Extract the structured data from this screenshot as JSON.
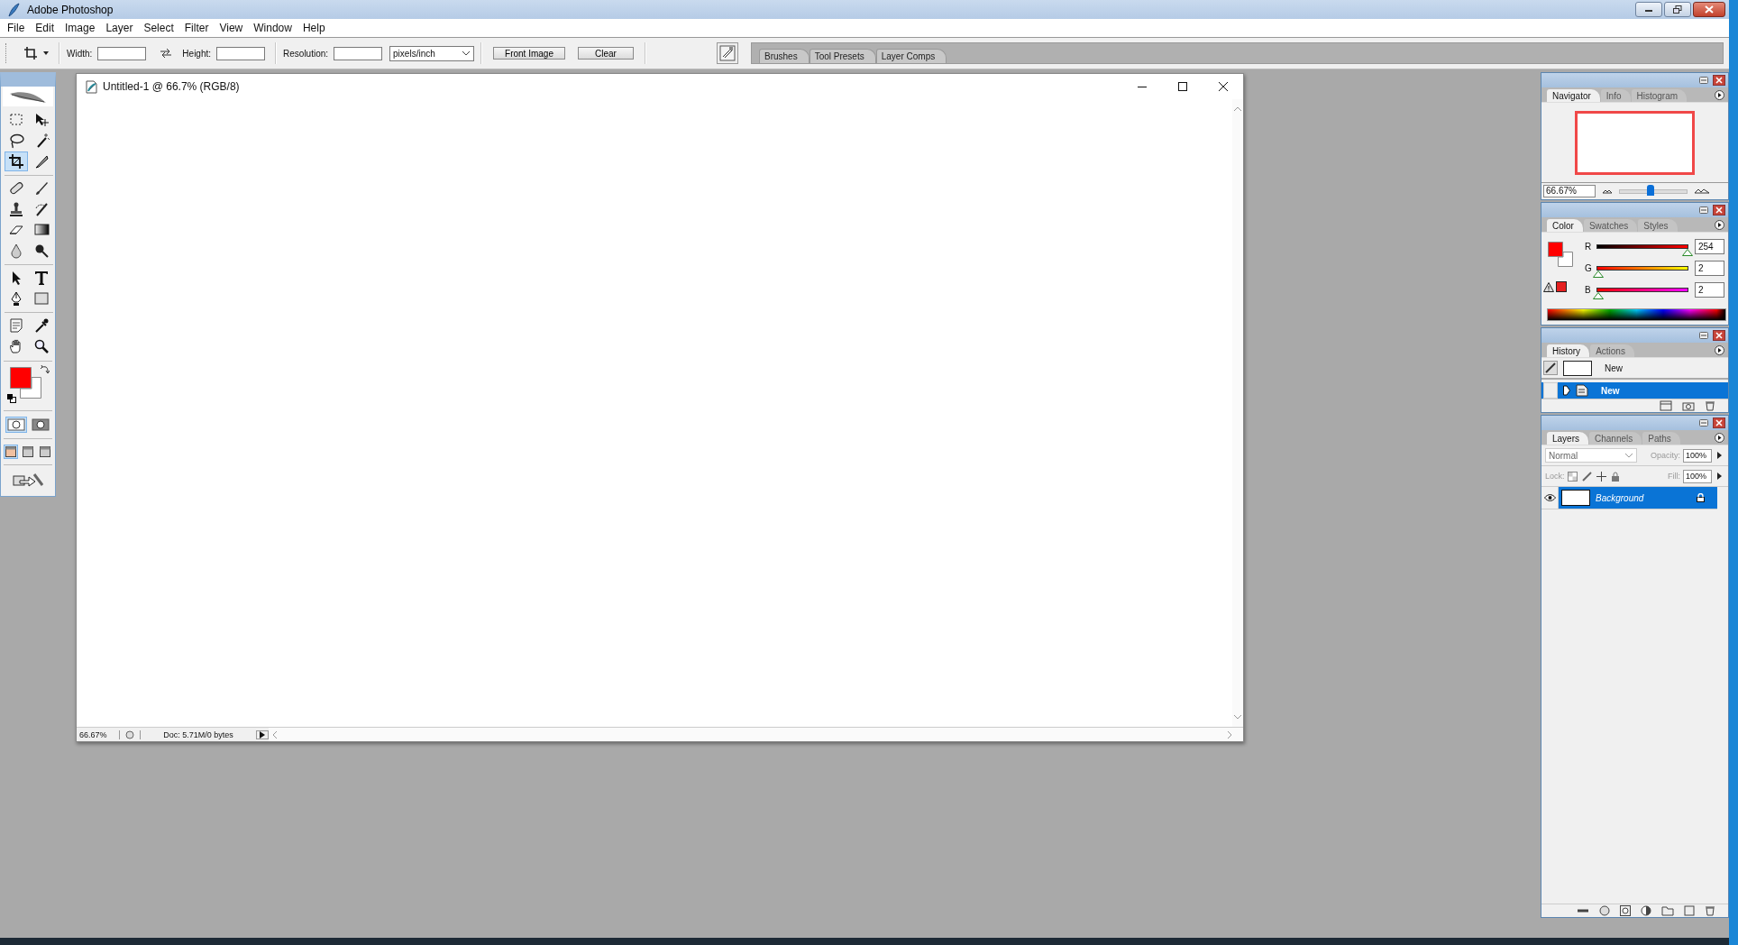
{
  "window": {
    "title": "Adobe Photoshop"
  },
  "menu": [
    "File",
    "Edit",
    "Image",
    "Layer",
    "Select",
    "Filter",
    "View",
    "Window",
    "Help"
  ],
  "options_bar": {
    "fields": [
      {
        "label": "Width:"
      },
      {
        "label": "Height:"
      },
      {
        "label": "Resolution:"
      }
    ],
    "unit": "pixels/inch",
    "buttons": [
      "Front Image",
      "Clear"
    ],
    "palette_well_tabs": [
      "Brushes",
      "Tool Presets",
      "Layer Comps"
    ]
  },
  "toolbox": {
    "tools": [
      {
        "kind": "marquee",
        "selected": false
      },
      {
        "kind": "move",
        "selected": false
      },
      {
        "kind": "lasso",
        "selected": false
      },
      {
        "kind": "wand",
        "selected": false
      },
      {
        "kind": "crop",
        "selected": true
      },
      {
        "kind": "slice",
        "selected": false
      },
      {
        "kind": "healing",
        "selected": false
      },
      {
        "kind": "brush",
        "selected": false
      },
      {
        "kind": "stamp",
        "selected": false
      },
      {
        "kind": "historybrush",
        "selected": false
      },
      {
        "kind": "eraser",
        "selected": false
      },
      {
        "kind": "gradient",
        "selected": false
      },
      {
        "kind": "blur",
        "selected": false
      },
      {
        "kind": "dodge",
        "selected": false
      },
      {
        "kind": "pathselect",
        "selected": false
      },
      {
        "kind": "type",
        "selected": false
      },
      {
        "kind": "pen",
        "selected": false
      },
      {
        "kind": "shape",
        "selected": false
      },
      {
        "kind": "notes",
        "selected": false
      },
      {
        "kind": "eyedropper",
        "selected": false
      },
      {
        "kind": "hand",
        "selected": false
      },
      {
        "kind": "zoom",
        "selected": false
      }
    ],
    "swatches": [
      {
        "kind": "foreground",
        "color": "#ff0000"
      },
      {
        "kind": "background",
        "color": "#ffffff"
      }
    ],
    "mask_modes": [
      {
        "selected": true
      },
      {
        "selected": false
      }
    ],
    "screen_modes": [
      {
        "selected": true
      },
      {
        "selected": false
      },
      {
        "selected": false
      }
    ]
  },
  "document": {
    "title": "Untitled-1 @ 66.7% (RGB/8)",
    "zoom": "66.67%",
    "info": "Doc: 5.71M/0 bytes"
  },
  "navigator": {
    "tabs": [
      {
        "label": "Navigator",
        "selected": true
      },
      {
        "label": "Info",
        "selected": false
      },
      {
        "label": "Histogram",
        "selected": false
      }
    ],
    "zoom": "66.67%",
    "level": 0.46
  },
  "color_panel": {
    "tabs": [
      {
        "label": "Color",
        "selected": true
      },
      {
        "label": "Swatches",
        "selected": false
      },
      {
        "label": "Styles",
        "selected": false
      }
    ],
    "swatches": [
      {
        "kind": "foreground",
        "color": "#ff0000"
      },
      {
        "kind": "background",
        "color": "#ffffff"
      }
    ],
    "channels": [
      {
        "name": "R",
        "value": "254",
        "level": 0.996
      },
      {
        "name": "G",
        "value": "2",
        "level": 0.008
      },
      {
        "name": "B",
        "value": "2",
        "level": 0.008
      }
    ],
    "gamut_warning": {
      "color": "#e52020"
    }
  },
  "history": {
    "tabs": [
      {
        "label": "History",
        "selected": true
      },
      {
        "label": "Actions",
        "selected": false
      }
    ],
    "items": [
      {
        "kind": "snapshot",
        "label": "New",
        "selected": false
      },
      {
        "kind": "state",
        "label": "New",
        "selected": true
      }
    ]
  },
  "layers": {
    "tabs": [
      {
        "label": "Layers",
        "selected": true
      },
      {
        "label": "Channels",
        "selected": false
      },
      {
        "label": "Paths",
        "selected": false
      }
    ],
    "blend_mode": "Normal",
    "opacity_label": "Opacity:",
    "opacity": "100%",
    "lock_label": "Lock:",
    "fill_label": "Fill:",
    "fill": "100%",
    "items": [
      {
        "name": "Background",
        "selected": true,
        "visible": true,
        "locked": true
      }
    ]
  }
}
